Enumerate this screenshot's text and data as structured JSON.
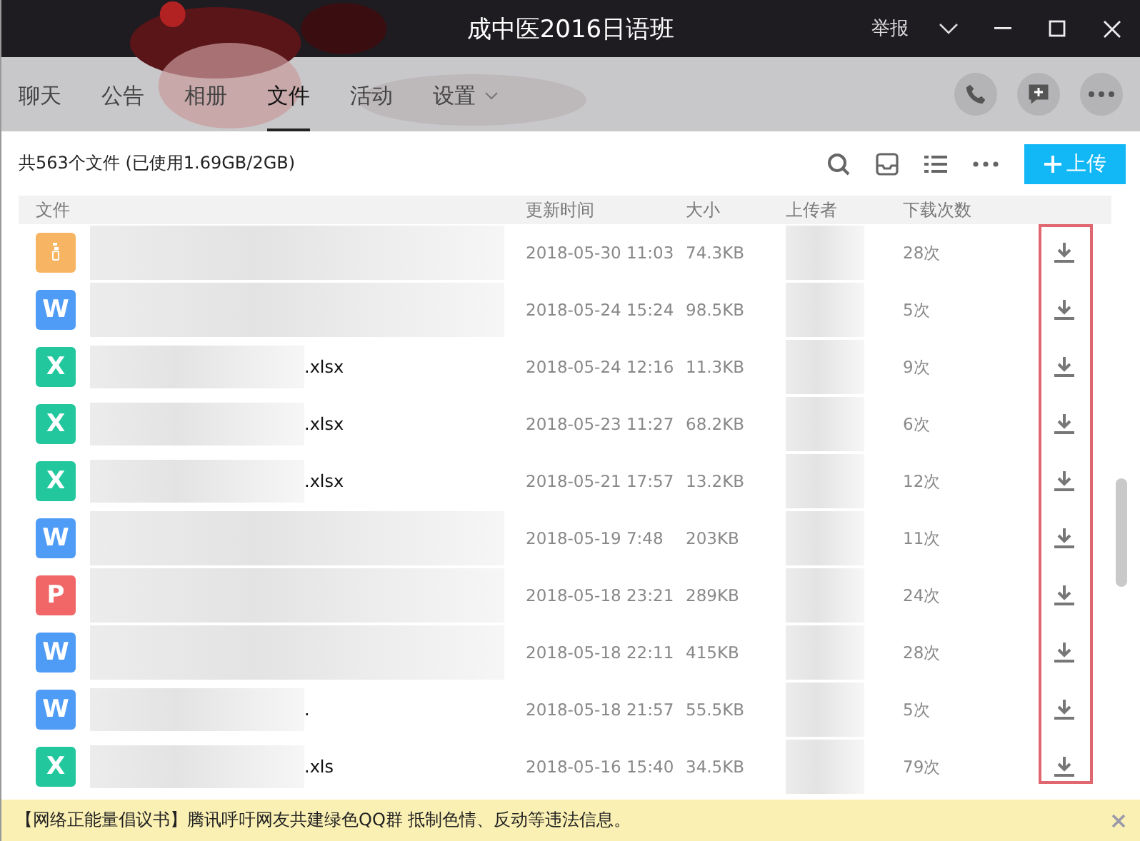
{
  "window": {
    "title": "成中医2016日语班",
    "report": "举报"
  },
  "tabs": [
    {
      "label": "聊天",
      "selected": false
    },
    {
      "label": "公告",
      "selected": false
    },
    {
      "label": "相册",
      "selected": false
    },
    {
      "label": "文件",
      "selected": true
    },
    {
      "label": "活动",
      "selected": false
    },
    {
      "label": "设置",
      "selected": false,
      "dropdown": true
    }
  ],
  "summary": "共563个文件 (已使用1.69GB/2GB)",
  "upload_button": "上传",
  "table": {
    "columns": [
      "文件",
      "更新时间",
      "大小",
      "上传者",
      "下载次数"
    ],
    "rows": [
      {
        "kind": "zip",
        "name": "",
        "time": "2018-05-30 11:03",
        "size": "74.3KB",
        "downloads": "28次"
      },
      {
        "kind": "word",
        "badge": "W",
        "name": "",
        "time": "2018-05-24 15:24",
        "size": "98.5KB",
        "downloads": "5次"
      },
      {
        "kind": "excel",
        "badge": "X",
        "name": ".xlsx",
        "time": "2018-05-24 12:16",
        "size": "11.3KB",
        "downloads": "9次"
      },
      {
        "kind": "excel",
        "badge": "X",
        "name": ".xlsx",
        "time": "2018-05-23 11:27",
        "size": "68.2KB",
        "downloads": "6次"
      },
      {
        "kind": "excel",
        "badge": "X",
        "name": ".xlsx",
        "time": "2018-05-21 17:57",
        "size": "13.2KB",
        "downloads": "12次"
      },
      {
        "kind": "word",
        "badge": "W",
        "name": "",
        "time": "2018-05-19 7:48",
        "size": "203KB",
        "downloads": "11次"
      },
      {
        "kind": "ppt",
        "badge": "P",
        "name": "",
        "time": "2018-05-18 23:21",
        "size": "289KB",
        "downloads": "24次"
      },
      {
        "kind": "word",
        "badge": "W",
        "name": "",
        "time": "2018-05-18 22:11",
        "size": "415KB",
        "downloads": "28次"
      },
      {
        "kind": "word",
        "badge": "W",
        "name": ".",
        "time": "2018-05-18 21:57",
        "size": "55.5KB",
        "downloads": "5次"
      },
      {
        "kind": "excel",
        "badge": "X",
        "name": ".xls",
        "time": "2018-05-16 15:40",
        "size": "34.5KB",
        "downloads": "79次"
      }
    ]
  },
  "banner": {
    "text": "【网络正能量倡议书】腾讯呼吁网友共建绿色QQ群 抵制色情、反动等违法信息。"
  }
}
